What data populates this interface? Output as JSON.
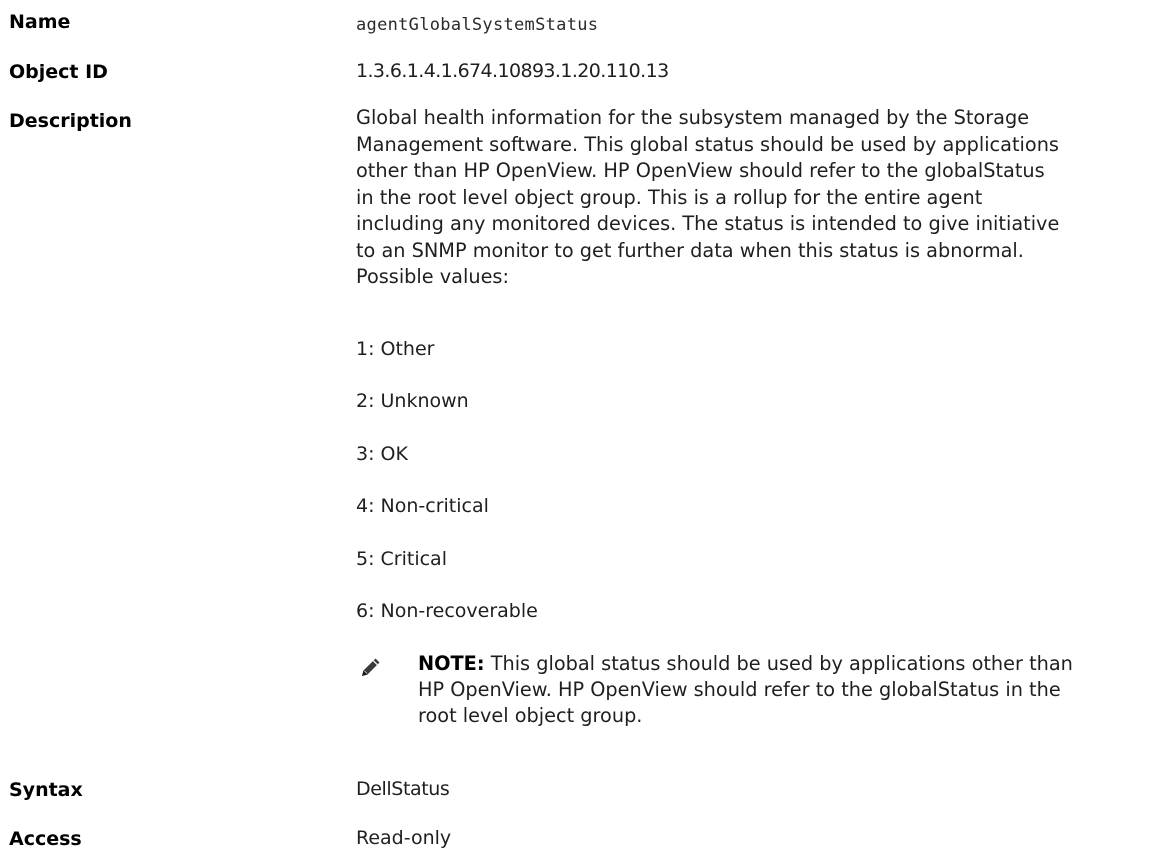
{
  "fields": {
    "name": {
      "label": "Name",
      "value": "agentGlobalSystemStatus"
    },
    "object_id": {
      "label": "Object ID",
      "value": "1.3.6.1.4.1.674.10893.1.20.110.13"
    },
    "description": {
      "label": "Description",
      "lines": [
        "Global health information for the subsystem managed by the Storage",
        "Management software. This global status should be used by applications",
        "other than HP OpenView. HP OpenView should refer to the globalStatus",
        "in the root level object group. This is a rollup for the entire agent",
        "including any monitored devices. The status is intended to give initiative",
        "to an SNMP monitor to get further data when this status is abnormal.",
        "Possible values:"
      ],
      "possible_values": [
        "1: Other",
        "2: Unknown",
        "3: OK",
        "4: Non-critical",
        "5: Critical",
        "6: Non-recoverable"
      ],
      "note": {
        "icon": "pencil-note-icon",
        "prefix": "NOTE:",
        "lines": [
          " This global status should be used by applications other than",
          "HP OpenView. HP OpenView should refer to the globalStatus in the",
          "root level object group."
        ]
      }
    },
    "syntax": {
      "label": "Syntax",
      "value": "DellStatus"
    },
    "access": {
      "label": "Access",
      "value": "Read-only"
    }
  }
}
